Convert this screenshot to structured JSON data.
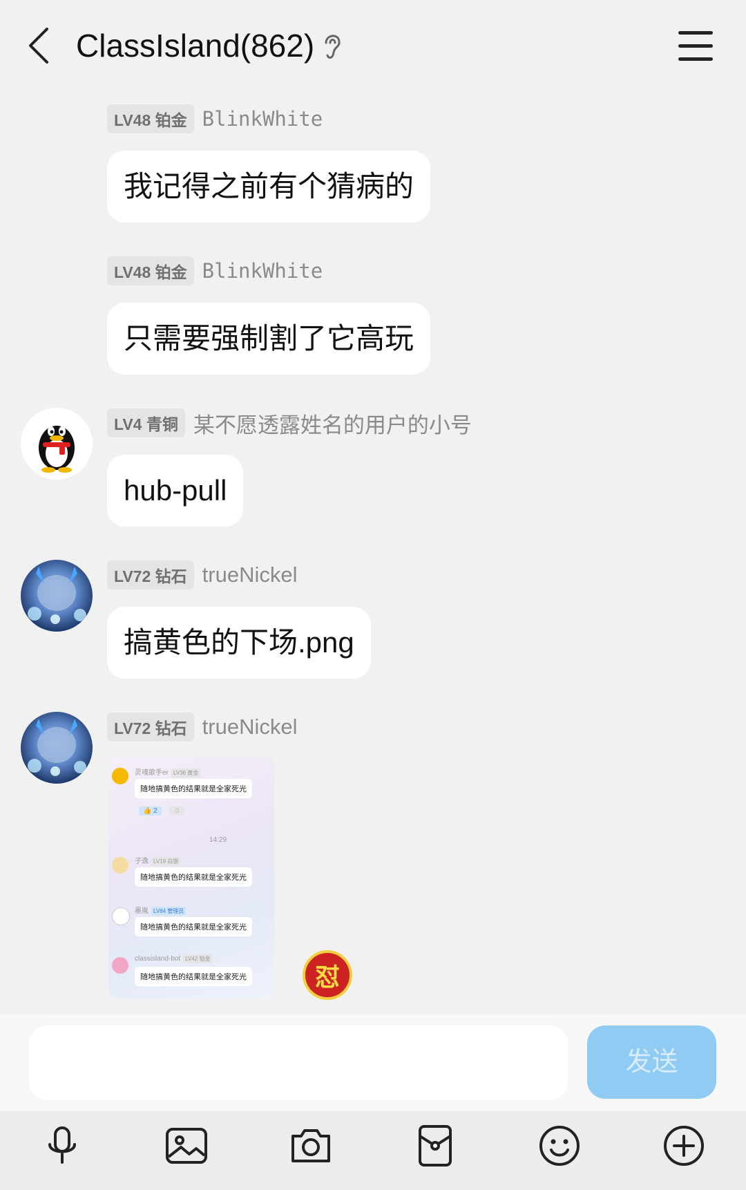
{
  "header": {
    "title": "ClassIsland(862)",
    "back_icon": "chevron-left-icon",
    "ear_icon": "ear-icon",
    "menu_icon": "hamburger-menu-icon"
  },
  "messages": [
    {
      "badge": "LV48 铂金",
      "nick": "BlinkWhite",
      "text": "我记得之前有个猜病的"
    },
    {
      "badge": "LV48 铂金",
      "nick": "BlinkWhite",
      "text": "只需要强制割了它高玩"
    },
    {
      "badge": "LV4 青铜",
      "nick": "某不愿透露姓名的用户的小号",
      "text": "hub-pull"
    },
    {
      "badge": "LV72 钻石",
      "nick": "trueNickel",
      "text": "搞黄色的下场.png"
    },
    {
      "badge": "LV72 钻石",
      "nick": "trueNickel"
    }
  ],
  "image_message": {
    "rows": [
      {
        "name": "灵魂歌手er",
        "tag": "LV36 黄金",
        "text": "随地搞黄色的结果就是全家死光",
        "likes": "2"
      },
      {
        "name": "子逸",
        "tag": "LV19 白银",
        "text": "随地搞黄色的结果就是全家死光"
      },
      {
        "name": "墨胤",
        "tag": "LV84 管理员",
        "text": "随地搞黄色的结果就是全家死光"
      },
      {
        "name": "classisland-bot",
        "tag": "LV42 铂金",
        "text": "随地搞黄色的结果就是全家死光"
      }
    ],
    "time": "14:29"
  },
  "sticker": {
    "glyph": "怼"
  },
  "composer": {
    "placeholder": "",
    "send_label": "发送"
  },
  "toolbar": [
    "microphone-icon",
    "image-icon",
    "camera-icon",
    "red-packet-icon",
    "emoji-icon",
    "plus-icon"
  ],
  "colors": {
    "send_button": "#8fcbf3",
    "background": "#f1f1f1"
  }
}
